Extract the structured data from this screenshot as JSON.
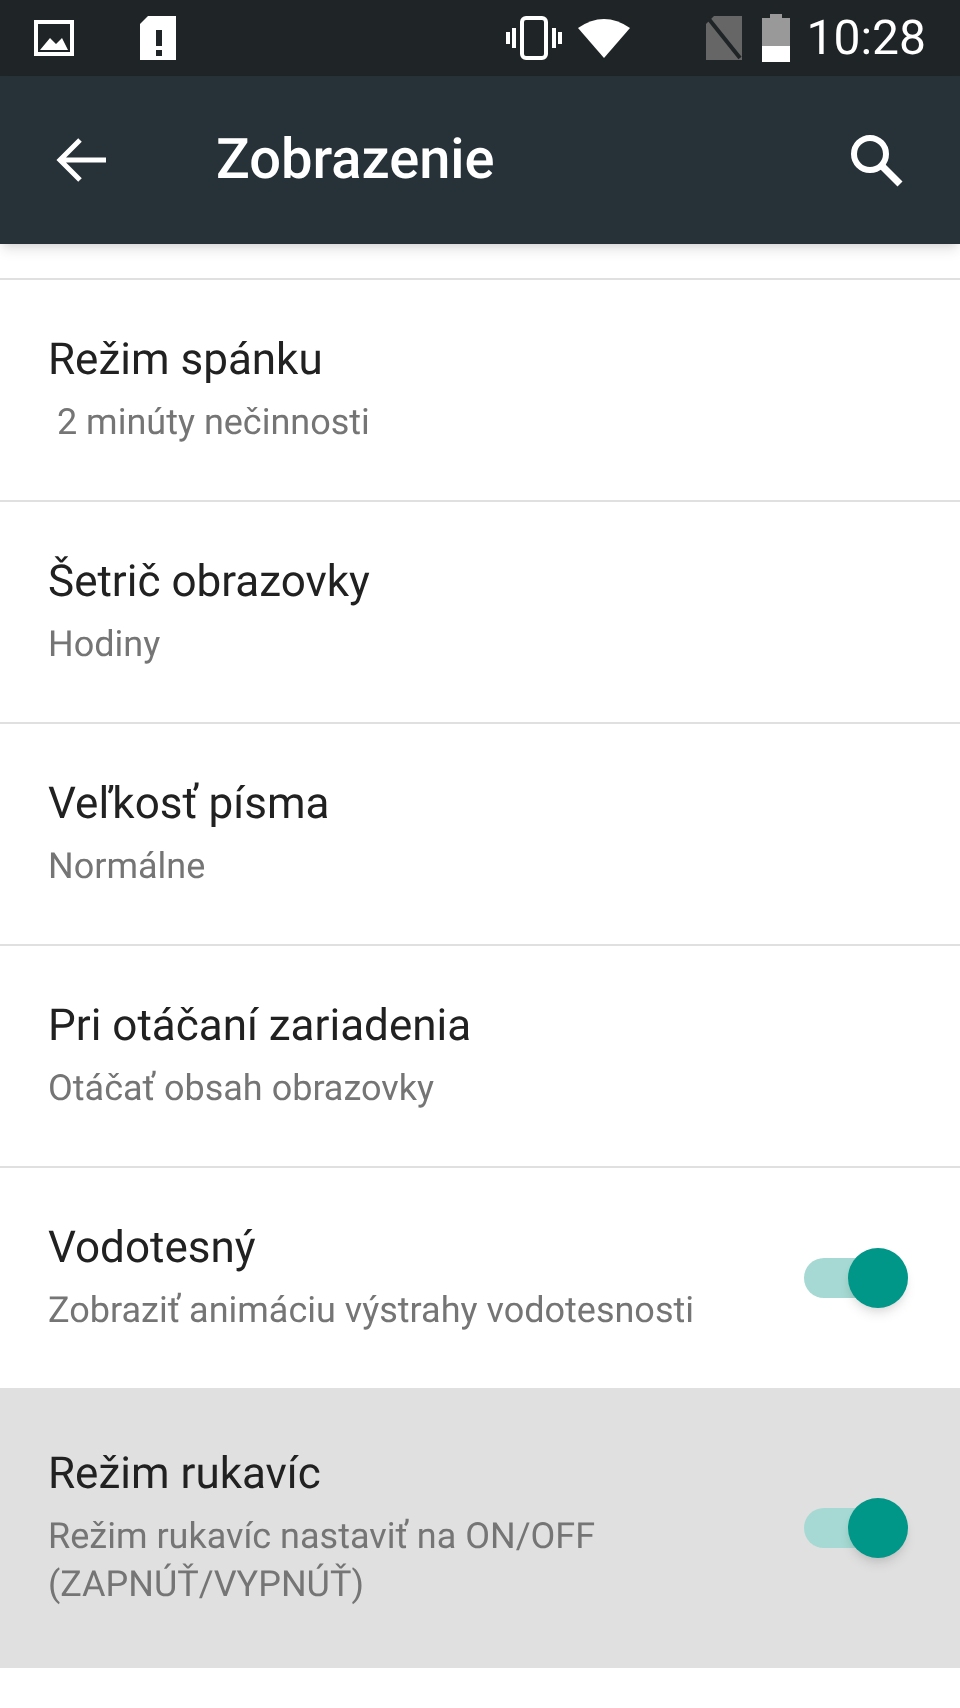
{
  "status_bar": {
    "time": "10:28"
  },
  "app_bar": {
    "title": "Zobrazenie"
  },
  "items": [
    {
      "kind": "text",
      "title": "Režim spánku",
      "summary": " 2 minúty nečinnosti",
      "pressed": false
    },
    {
      "kind": "text",
      "title": "Šetrič obrazovky",
      "summary": "Hodiny",
      "pressed": false
    },
    {
      "kind": "text",
      "title": "Veľkosť písma",
      "summary": "Normálne",
      "pressed": false
    },
    {
      "kind": "text",
      "title": "Pri otáčaní zariadenia",
      "summary": "Otáčať obsah obrazovky",
      "pressed": false
    },
    {
      "kind": "switch",
      "title": "Vodotesný",
      "summary": "Zobraziť animáciu výstrahy vodotesnosti",
      "on": true,
      "pressed": false
    },
    {
      "kind": "switch",
      "title": "Režim rukavíc",
      "summary": "Režim rukavíc nastaviť na ON/OFF (ZAPNÚŤ/VYPNÚŤ)",
      "on": true,
      "pressed": true
    }
  ]
}
